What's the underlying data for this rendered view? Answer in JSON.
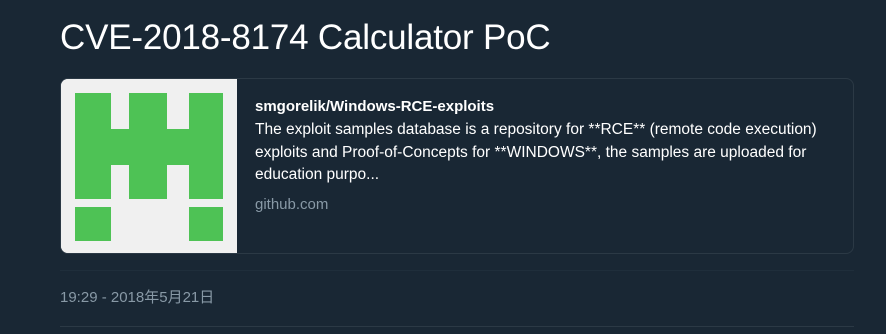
{
  "tweet": {
    "text": "CVE-2018-8174 Calculator PoC",
    "timestamp": "19:29 - 2018年5月21日"
  },
  "link_card": {
    "title": "smgorelik/Windows-RCE-exploits",
    "description": "The exploit samples database is a repository for **RCE** (remote code execution) exploits and Proof-of-Concepts for **WINDOWS**, the samples are uploaded for education purpo...",
    "domain": "github.com",
    "thumbnail_icon": "github-identicon",
    "colors": {
      "identicon": "#4ec255",
      "identicon_bg": "#f0f0f0"
    }
  },
  "colors": {
    "background": "#192734",
    "text": "#ffffff",
    "muted": "#8899a6"
  }
}
